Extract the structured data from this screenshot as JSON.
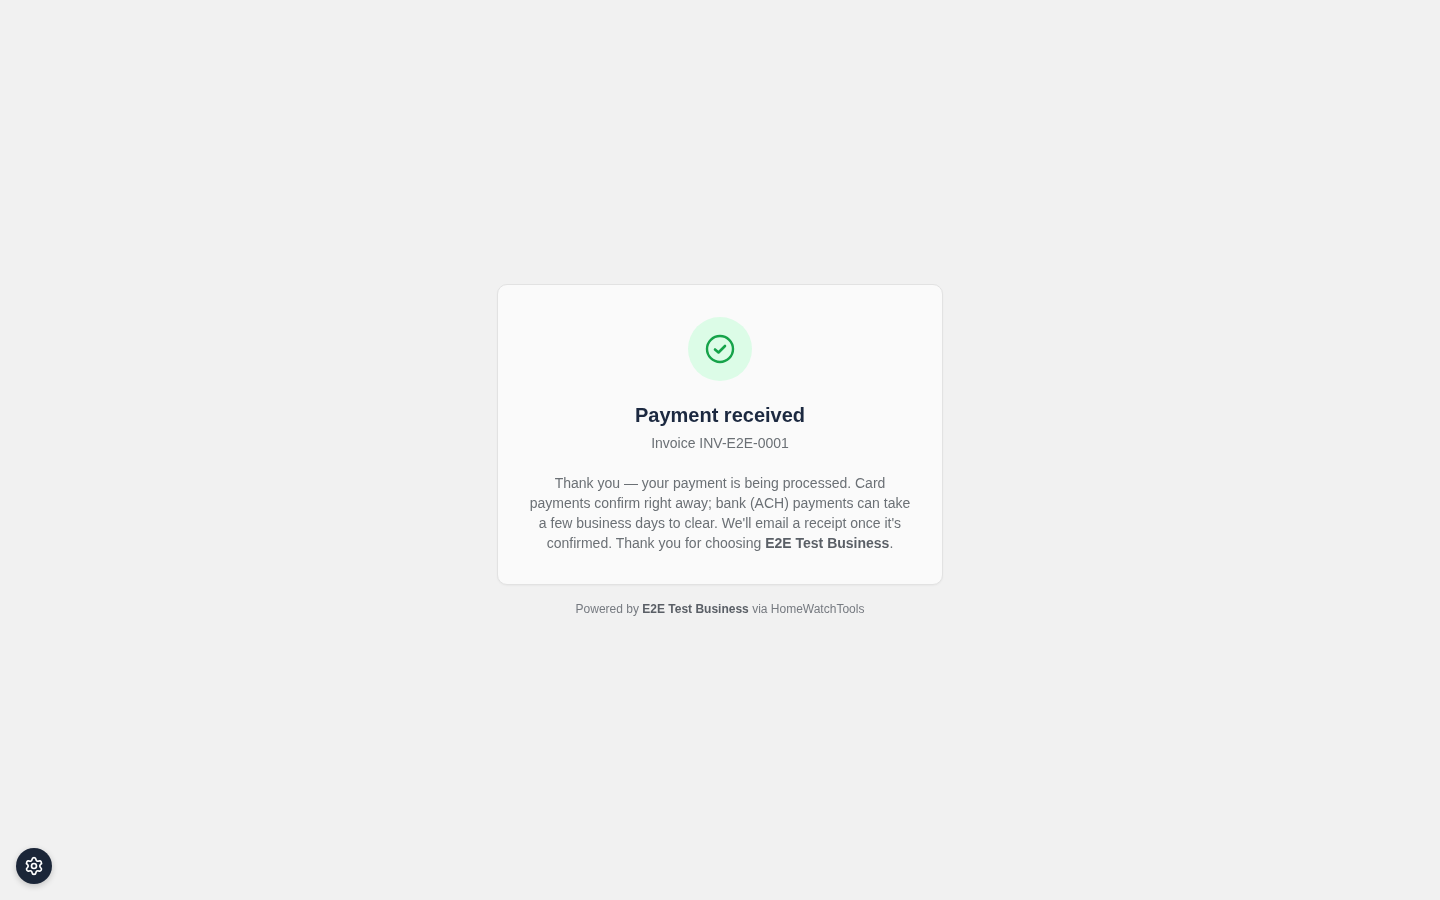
{
  "card": {
    "title": "Payment received",
    "invoice": "Invoice INV-E2E-0001",
    "message": "Thank you — your payment is being processed. Card payments confirm right away; bank (ACH) payments can take a few business days to clear. We'll email a receipt once it's confirmed. Thank you for choosing **E2E Test Business**."
  },
  "footer": {
    "text": "Powered by **E2E Test Business** via HomeWatchTools"
  }
}
